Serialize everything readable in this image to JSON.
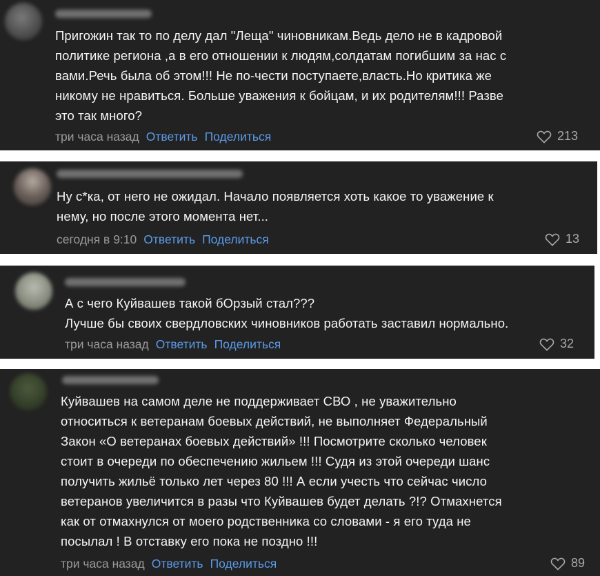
{
  "comments": [
    {
      "lines": [
        "Пригожин так то по делу дал \"Леща\" чиновникам.Ведь дело не в кадровой",
        "политике региона ,а в его отношении к людям,солдатам погибшим за нас с",
        "вами.Речь была об этом!!! Не по-чести поступаете,власть.Но критика же",
        "никому не нравиться. Больше уважения к бойцам, и их родителям!!! Разве",
        "это так много?"
      ],
      "time": "три часа назад",
      "reply_label": "Ответить",
      "share_label": "Поделиться",
      "likes": "213",
      "icon": "heart-outline-icon"
    },
    {
      "lines": [
        "Ну с*ка, от него не ожидал. Начало появляется хоть какое то уважение к",
        "нему, но после этого момента нет..."
      ],
      "time": "сегодня в 9:10",
      "reply_label": "Ответить",
      "share_label": "Поделиться",
      "likes": "13",
      "icon": "heart-outline-icon"
    },
    {
      "lines": [
        "А с чего Куйвашев такой бОрзый стал???",
        "Лучше бы своих свердловских чиновников работать заставил нормально."
      ],
      "time": "три часа назад",
      "reply_label": "Ответить",
      "share_label": "Поделиться",
      "likes": "32",
      "icon": "heart-outline-icon"
    },
    {
      "lines": [
        "Куйвашев на самом деле не поддерживает СВО , не уважительно",
        "относиться к ветеранам боевых действий, не выполняет Федеральный",
        "Закон «О ветеранах боевых действий» !!! Посмотрите сколько человек",
        "стоит в очереди по обеспечению жильем !!! Судя из этой очереди шанс",
        "получить жильё только лет через 80 !!! А если учесть что сейчас число",
        "ветеранов увеличится в разы что Куйвашев будет делать ?!? Отмахнется",
        "как от отмахнулся от моего родственника со словами - я его туда не",
        "посылал ! В отставку его пока не поздно !!!"
      ],
      "time": "три часа назад",
      "reply_label": "Ответить",
      "share_label": "Поделиться",
      "likes": "89",
      "icon": "heart-outline-icon"
    }
  ],
  "colors": {
    "card_bg": "#222222",
    "text": "#f5f5f5",
    "meta": "#9a9a9a",
    "link": "#5b9be8",
    "page_bg": "#ffffff"
  }
}
